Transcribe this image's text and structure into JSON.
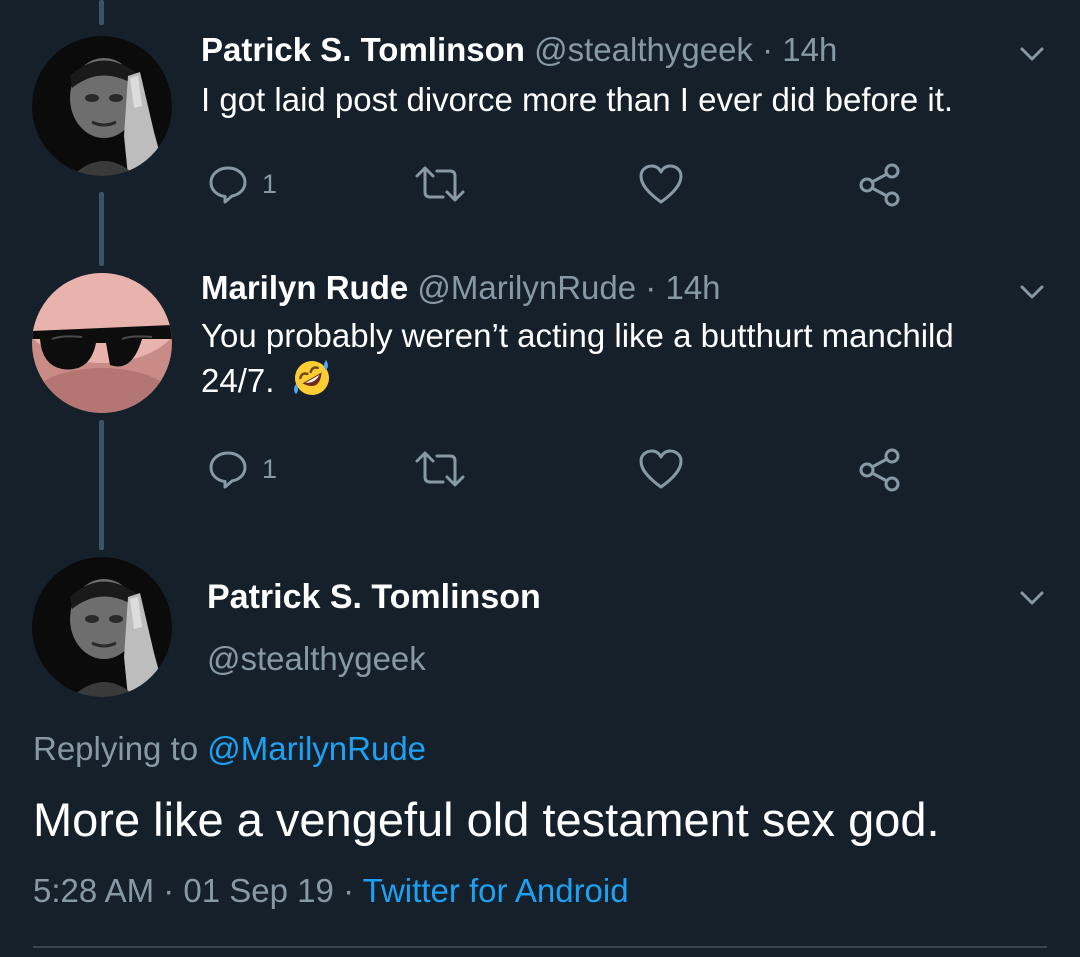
{
  "tweets": [
    {
      "name": "Patrick S. Tomlinson",
      "handle": "@stealthygeek",
      "separator": "·",
      "time": "14h",
      "text": "I got laid post divorce more than I ever did before it.",
      "reply_count": "1",
      "avatar_icon": "man-pointing-at-temple-avatar"
    },
    {
      "name": "Marilyn Rude",
      "handle": "@MarilynRude",
      "separator": "·",
      "time": "14h",
      "text": "You probably weren’t acting like a butthurt manchild 24/7.",
      "emoji": "rolling-on-floor-laughing-emoji",
      "reply_count": "1",
      "avatar_icon": "man-in-sunglasses-avatar"
    }
  ],
  "main_tweet": {
    "name": "Patrick S. Tomlinson",
    "handle": "@stealthygeek",
    "replying_prefix": "Replying to",
    "replying_to": "@MarilynRude",
    "text": "More like a vengeful old testament sex god.",
    "time": "5:28 AM",
    "date": "01 Sep 19",
    "separator": "·",
    "source": "Twitter for Android"
  },
  "colors": {
    "background": "#15202b",
    "text_primary": "#ffffff",
    "text_secondary": "#8899a6",
    "link": "#1da1f2",
    "thread_line": "#3d5466"
  }
}
